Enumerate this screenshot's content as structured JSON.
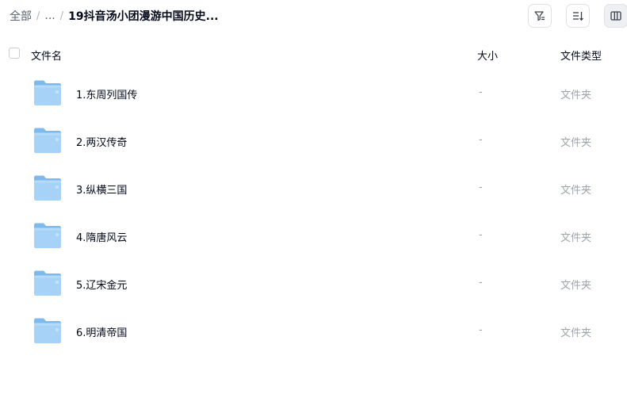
{
  "breadcrumb": {
    "root": "全部",
    "ellipsis": "...",
    "current": "19抖音汤小团漫游中国历史..."
  },
  "toolbar": {
    "filter_icon": "filter-icon",
    "sort_icon": "sort-icon",
    "view_icon": "column-view-icon"
  },
  "header": {
    "name": "文件名",
    "size": "大小",
    "type": "文件类型"
  },
  "files": [
    {
      "name": "1.东周列国传",
      "size": "-",
      "type": "文件夹",
      "icon": "folder-icon"
    },
    {
      "name": "2.两汉传奇",
      "size": "-",
      "type": "文件夹",
      "icon": "folder-icon"
    },
    {
      "name": "3.纵横三国",
      "size": "-",
      "type": "文件夹",
      "icon": "folder-icon"
    },
    {
      "name": "4.隋唐风云",
      "size": "-",
      "type": "文件夹",
      "icon": "folder-icon"
    },
    {
      "name": "5.辽宋金元",
      "size": "-",
      "type": "文件夹",
      "icon": "folder-icon"
    },
    {
      "name": "6.明清帝国",
      "size": "-",
      "type": "文件夹",
      "icon": "folder-icon"
    }
  ],
  "colors": {
    "folder_top": "#7db8ef",
    "folder_body": "#a6d2f8",
    "text_primary": "#03081a",
    "text_muted": "#9da2ab"
  }
}
